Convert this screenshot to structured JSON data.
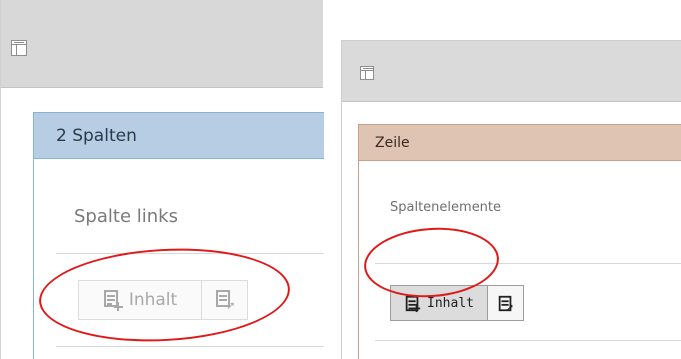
{
  "left_panel": {
    "grid_title": "2 Spalten",
    "column_label": "Spalte links",
    "content_button_label": "Inhalt"
  },
  "right_panel": {
    "grid_title": "Zeile",
    "column_label": "Spaltenelemente",
    "content_button_label": "Inhalt"
  },
  "icons": {
    "layout": "layout-grid-icon",
    "new_content": "new-content-icon",
    "paste": "paste-icon"
  },
  "colors": {
    "left_box_header": "#b7cde3",
    "right_box_header": "#dfc3b3",
    "highlight_circle": "#e01818"
  }
}
